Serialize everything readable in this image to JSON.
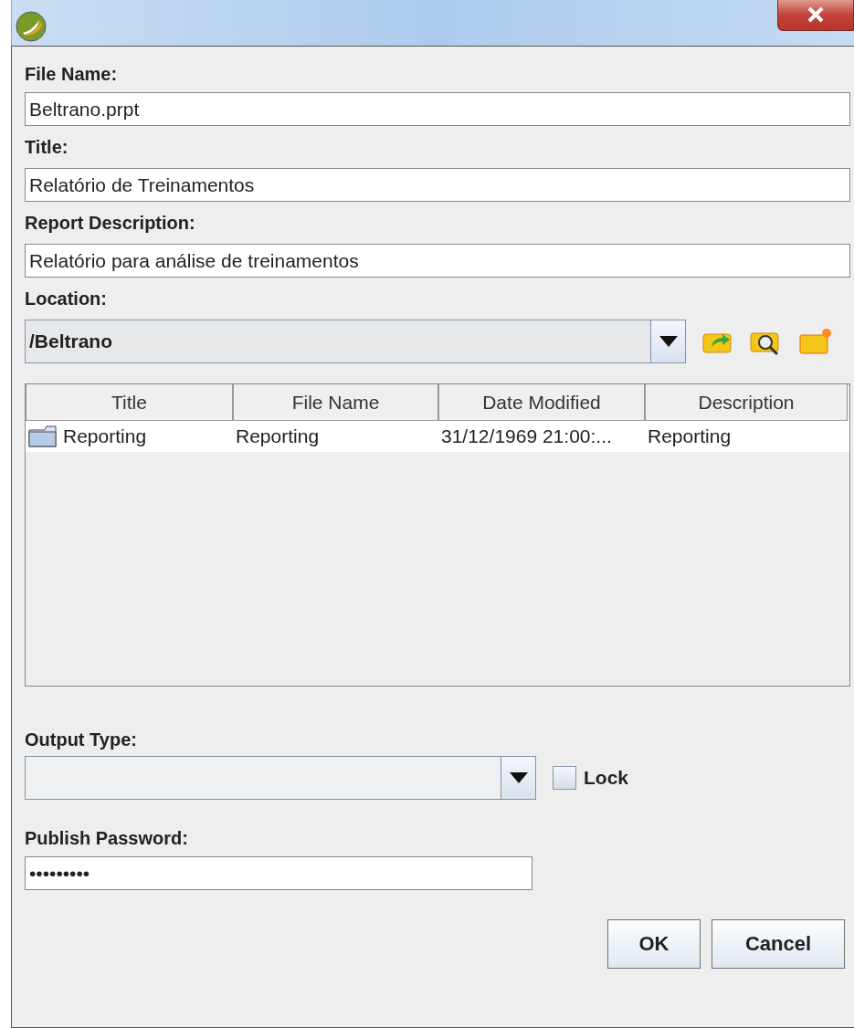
{
  "fields": [
    {
      "label": "File Name:",
      "value": "Beltrano.prpt"
    },
    {
      "label": "Title:",
      "value": "Relatório de Treinamentos"
    },
    {
      "label": "Report Description:",
      "value": "Relatório para análise de treinamentos"
    }
  ],
  "location": {
    "label": "Location:",
    "value": "/Beltrano"
  },
  "table": {
    "columns": [
      "Title",
      "File Name",
      "Date Modified",
      "Description"
    ],
    "rows": [
      {
        "kind": "folder",
        "cells": [
          "Reporting",
          "Reporting",
          "31/12/1969 21:00:...",
          "Reporting"
        ]
      }
    ]
  },
  "output_type": {
    "label": "Output Type:"
  },
  "lock": {
    "label": "Lock",
    "checked": false
  },
  "password": {
    "label": "Publish Password:",
    "value": "•••••••••"
  },
  "buttons": [
    "OK",
    "Cancel"
  ]
}
